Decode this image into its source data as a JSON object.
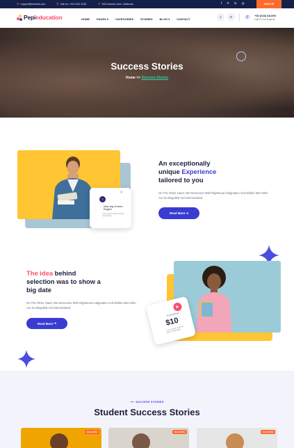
{
  "topbar": {
    "email": "support@website.com",
    "call": "Call us: +012-020-1230",
    "address": "345 Kearnis Lane, California",
    "signup": "SIGN UP"
  },
  "header": {
    "logo_prefix": "Pepi",
    "logo_accent": "education",
    "nav": [
      "HOME",
      "PAGES",
      "CATEGORIES",
      "STORIES",
      "BLOG",
      "CONTACT"
    ],
    "phone": "+92 (023) 68-090",
    "phone_sub": "Call To Our Experts"
  },
  "hero": {
    "title": "Success Stories",
    "crumb_home": "Home",
    "crumb_sep": ">>",
    "crumb_current": "Success Stories"
  },
  "about1": {
    "title_line1": "An exceptionally",
    "title_line2_pre": "unique ",
    "title_line2_hl": "Experience",
    "title_line3": "tailored to you",
    "body": "On The Other Hand, We Denounce With Righteous Indignation And Dislike Men Who Are So Beguiled And Demoralized",
    "button": "Read More",
    "card_title": "New way to learn English",
    "card_sub": "Lorem ipsum dolor sit amet consectetur"
  },
  "about2": {
    "title_hl": "The idea",
    "title_rest1": " behind",
    "title_line2": "selection was to show a",
    "title_line3": "big date",
    "body": "On The Other Hand, We Denounce With Righteous Indignation And Dislike Men Who Are So Beguiled And Demoralized",
    "button": "Read More",
    "card_label": "Everything",
    "card_price": "$10",
    "card_sub": "Lorem ipsum dolor sit amet consectetur"
  },
  "stories": {
    "tag": "SUCCESS STORIES",
    "title": "Student Success Stories",
    "cards": [
      {
        "badge": "06 HOURS"
      },
      {
        "badge": "06 HOURS"
      },
      {
        "badge": "06 HOURS"
      }
    ]
  },
  "colors": {
    "navy": "#15204a",
    "orange": "#ff6b2c",
    "primary": "#3a3cd1",
    "pink": "#ff4d6d",
    "yellow": "#ffc532",
    "teal": "#2fd3a3"
  }
}
